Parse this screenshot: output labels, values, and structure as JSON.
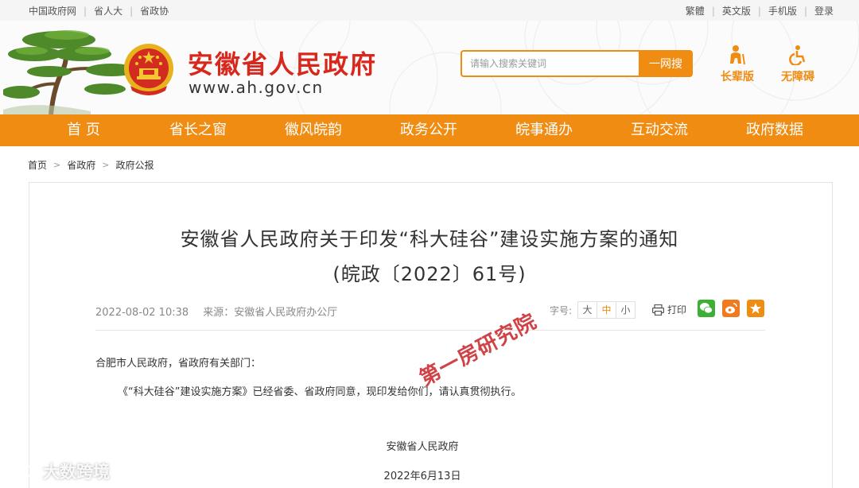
{
  "topbar": {
    "left_links": [
      "中国政府网",
      "省人大",
      "省政协"
    ],
    "right_links": [
      "繁體",
      "英文版",
      "手机版",
      "登录"
    ]
  },
  "header": {
    "site_title": "安徽省人民政府",
    "site_url": "www.ah.gov.cn",
    "search_placeholder": "请输入搜索关键词",
    "search_button": "一网搜",
    "tools": [
      {
        "label": "长辈版",
        "icon": "elder-icon"
      },
      {
        "label": "无障碍",
        "icon": "accessibility-icon"
      }
    ]
  },
  "nav": {
    "items": [
      "首 页",
      "省长之窗",
      "徽风皖韵",
      "政务公开",
      "皖事通办",
      "互动交流",
      "政府数据"
    ]
  },
  "breadcrumb": [
    "首页",
    "省政府",
    "政府公报"
  ],
  "article": {
    "title": "安徽省人民政府关于印发“科大硅谷”建设实施方案的通知",
    "doc_number": "(皖政〔2022〕61号)",
    "date": "2022-08-02 10:38",
    "source": "来源：安徽省人民政府办公厅",
    "font_size_label": "字号:",
    "font_sizes": [
      "大",
      "中",
      "小"
    ],
    "active_font_size": "中",
    "print_label": "打印",
    "share_icons": [
      "wechat-icon",
      "weibo-icon",
      "favorite-icon"
    ],
    "addressee": "合肥市人民政府，省政府有关部门：",
    "body": "《“科大硅谷”建设实施方案》已经省委、省政府同意，现印发给你们，请认真贯彻执行。",
    "signer": "安徽省人民政府",
    "sign_date": "2022年6月13日"
  },
  "overlays": {
    "stamp": "第一房研究院",
    "watermark": "大数跨境"
  },
  "colors": {
    "accent": "#f08c12",
    "title_red": "#d8281d",
    "stamp_red": "#c8191e"
  }
}
